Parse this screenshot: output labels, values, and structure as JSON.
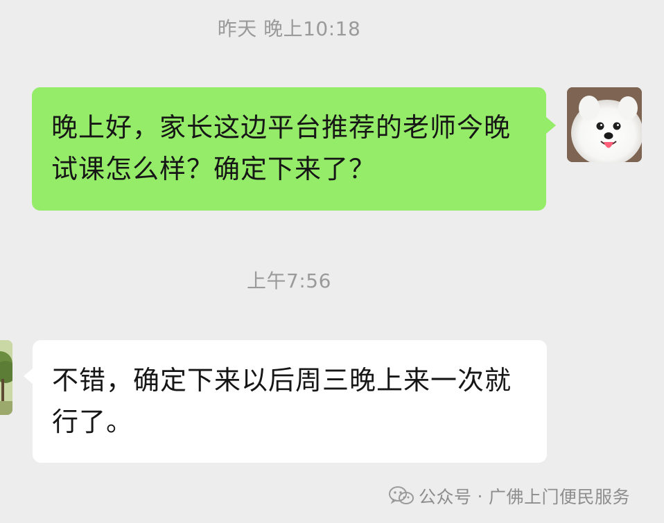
{
  "chat": {
    "messages": [
      {
        "timestamp": "昨天 晚上10:18",
        "direction": "outgoing",
        "text": "晚上好，家长这边平台推荐的老师今晚试课怎么样？确定下来了？",
        "bubble_color": "#95ec69"
      },
      {
        "timestamp": "上午7:56",
        "direction": "incoming",
        "text": "不错，确定下来以后周三晚上来一次就行了。",
        "bubble_color": "#ffffff"
      }
    ],
    "avatars": {
      "self_icon": "dog-avatar-icon",
      "other_icon": "tree-avatar-icon"
    }
  },
  "watermark": {
    "prefix": "公众号",
    "separator": "·",
    "name": "广佛上门便民服务",
    "icon": "wechat-icon"
  },
  "colors": {
    "background": "#ededed",
    "outgoing_bubble": "#95ec69",
    "incoming_bubble": "#ffffff",
    "timestamp_text": "#9a9a9a"
  }
}
